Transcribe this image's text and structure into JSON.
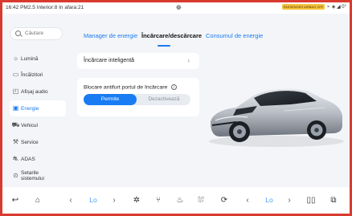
{
  "statusbar": {
    "left_text": "16:42  PM2.5 Interior:8  In afara:21",
    "passenger_badge": "PASSENGER AIRBAG OFF",
    "right_icons": "⚬ ◈ ◢ 0°"
  },
  "sidebar": {
    "search_placeholder": "Căutare",
    "items": [
      {
        "label": "Lumină",
        "icon": "sun-icon"
      },
      {
        "label": "Încălzitori",
        "icon": "heater-icon"
      },
      {
        "label": "Afișaj audio",
        "icon": "display-icon"
      },
      {
        "label": "Energie",
        "icon": "battery-icon",
        "active": true
      },
      {
        "label": "Vehicul",
        "icon": "car-icon"
      },
      {
        "label": "Service",
        "icon": "wrench-icon"
      },
      {
        "label": "ADAS",
        "icon": "adas-icon"
      },
      {
        "label": "Setarile sistemului",
        "icon": "settings-icon"
      }
    ]
  },
  "tabs": [
    {
      "label": "Manager de energie"
    },
    {
      "label": "Încărcare/descărcare",
      "active": true
    },
    {
      "label": "Consumul de energie"
    }
  ],
  "smart_charging": {
    "label": "Încărcare inteligentă"
  },
  "port_lock": {
    "title": "Blocare antifurt portul de încărcare",
    "options": [
      "Permite",
      "Dezactivează"
    ],
    "selected": "Permite"
  },
  "bottom_bar": {
    "left_temp": "Lo",
    "right_temp": "Lo"
  },
  "colors": {
    "accent": "#1a7cf2",
    "frame": "#d83a2f"
  }
}
